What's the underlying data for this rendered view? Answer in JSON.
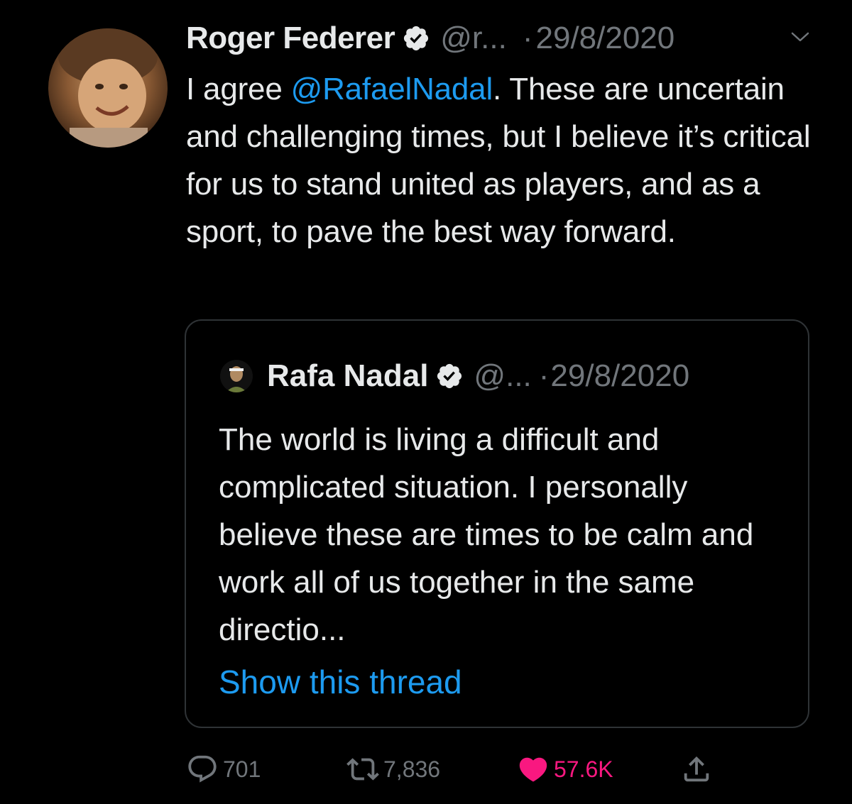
{
  "tweet": {
    "author_name": "Roger Federer",
    "author_handle": "@r...",
    "separator": "·",
    "date": "29/8/2020",
    "text_before": "I agree ",
    "mention": "@RafaelNadal",
    "text_after": ". These are uncertain and challenging times, but I believe it’s critical for us to stand united as players, and as a sport, to pave the best way forward."
  },
  "quote": {
    "author_name": "Rafa Nadal",
    "author_handle": "@...",
    "separator": "·",
    "date": "29/8/2020",
    "text": "The world is living a difficult and complicated situation. I personally believe these are times to be calm and work all of us together in the same directio...",
    "show_thread": "Show this thread"
  },
  "actions": {
    "replies": "701",
    "retweets": "7,836",
    "likes": "57.6K"
  },
  "icons": {
    "verified": "verified-badge-icon",
    "caret": "chevron-down-icon",
    "reply": "reply-icon",
    "retweet": "retweet-icon",
    "like": "heart-icon",
    "share": "share-icon"
  },
  "colors": {
    "background": "#000000",
    "text": "#e7e9ea",
    "secondary": "#71767b",
    "link": "#1d9bf0",
    "like": "#f91880",
    "border": "#2f3336"
  }
}
